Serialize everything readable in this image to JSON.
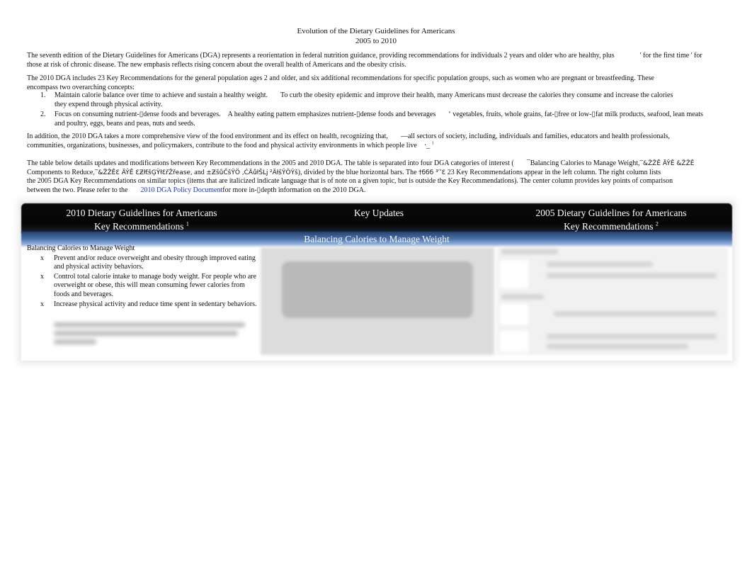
{
  "document": {
    "title_line1": "Evolution of the Dietary Guidelines for Americans",
    "title_line2": "2005 to 2010",
    "intro": {
      "part1": "The seventh edition of the Dietary Guidelines for Americans (DGA) represents a reorientation in federal nutrition guidance, providing recommendations for individuals 2 years and older who are healthy, plus",
      "mark1": "'",
      "part2": "for the first time",
      "mark2": "'",
      "part3": "for",
      "line2": "those at risk of chronic disease. The new emphasis reflects rising concern about the overall health of Americans and the obesity crisis."
    },
    "para2": {
      "line1": "The 2010 DGA includes 23 Key Recommendations for the general population ages 2 and older, and six additional recommendations for specific population groups, such as women who are pregnant or breastfeeding. These",
      "line2": "encompass two overarching concepts:"
    },
    "concepts": [
      {
        "num": "1.",
        "lead": "Maintain calorie balance over time to achieve and sustain a healthy weight.",
        "rest": "To curb the obesity epidemic and improve their health, many Americans must decrease the calories they consume and increase the calories",
        "line2": "they expend through physical activity."
      },
      {
        "num": "2.",
        "lead": "Focus on consuming nutrient-▯dense foods and beverages.",
        "rest": "A healthy eating pattern emphasizes nutrient-▯dense foods and beverages",
        "mark": "‘",
        "rest2": "vegetables, fruits, whole grains, fat-▯free or low-▯fat milk products, seafood, lean meats",
        "line2": "and poultry, eggs, beans and peas, nuts and seeds."
      }
    ],
    "para3": {
      "line1a": "In addition, the 2010 DGA takes a more comprehensive view of the food environment and its effect on health, recognizing that,",
      "mark": "—",
      "line1b": "all sectors of society, including, individuals and families, educators and health professionals,",
      "line2": "communities, organizations, businesses, and policymakers, contribute to the food and physical activity environments in which people live",
      "endmark": "·_",
      "footnote": "1"
    },
    "para4": {
      "line1a": "The table below details updates and modifications between Key Recommendations in the 2005 and 2010 DGA. The table is separated into four DGA categories of interest (",
      "mark": "¯",
      "line1b": "Balancing Calories to Manage Weight,",
      "garble1": "‾&ŽŽĚ ÄŶĚ &ŽŽĚ",
      "line2a": "Components to Reduce,",
      "garble2": "‾&ŽŽĚƐ ÄŶĚ ƐƵłƭšĢŶłƐřŽřease,",
      "line2b": "and",
      "garble3": "±ƵšůĈšŶÖ ,ĆÄůłŠǈ ²ÄłšŶÖŶš",
      "line2c": "), divided by the blue horizontal bars. The",
      "garble4": "†ббб ³ʹʹƐ",
      "line2d": "23 Key Recommendations appear in the left column. The right column lists",
      "line3": "the 2005 DGA Key Recommendations on similar topics (items that are  italicized indicate language that is of note on a given topic, but is outside the Key Recommendations). The center column provides key points of comparison",
      "line4a": "between the two. Please refer to the",
      "link": "2010 DGA Policy Document",
      "line4b": "for more in-▯depth information on the 2010 DGA."
    }
  },
  "table": {
    "headers": [
      {
        "line1": "2010 Dietary Guidelines for Americans",
        "line2": "Key Recommendations",
        "footnote": "1"
      },
      {
        "line1": "Key Updates",
        "line2": "",
        "footnote": ""
      },
      {
        "line1": "2005 Dietary Guidelines for Americans",
        "line2": "Key Recommendations",
        "footnote": "2"
      }
    ],
    "category_bar": "Balancing Calories to Manage Weight",
    "left_column": {
      "category": "Balancing Calories to Manage Weight",
      "bullet_marker": "x",
      "bullets": [
        "Prevent and/or reduce overweight and obesity through improved eating and physical activity behaviors.",
        "Control total calorie intake to manage body weight. For people who are overweight or obese, this will mean consuming fewer calories from foods and beverages.",
        "Increase physical activity and reduce time spent in sedentary behaviors."
      ]
    }
  },
  "colors": {
    "header_bg": "#050505",
    "category_bar": "#4a6fa8",
    "link": "#1a35c8"
  }
}
